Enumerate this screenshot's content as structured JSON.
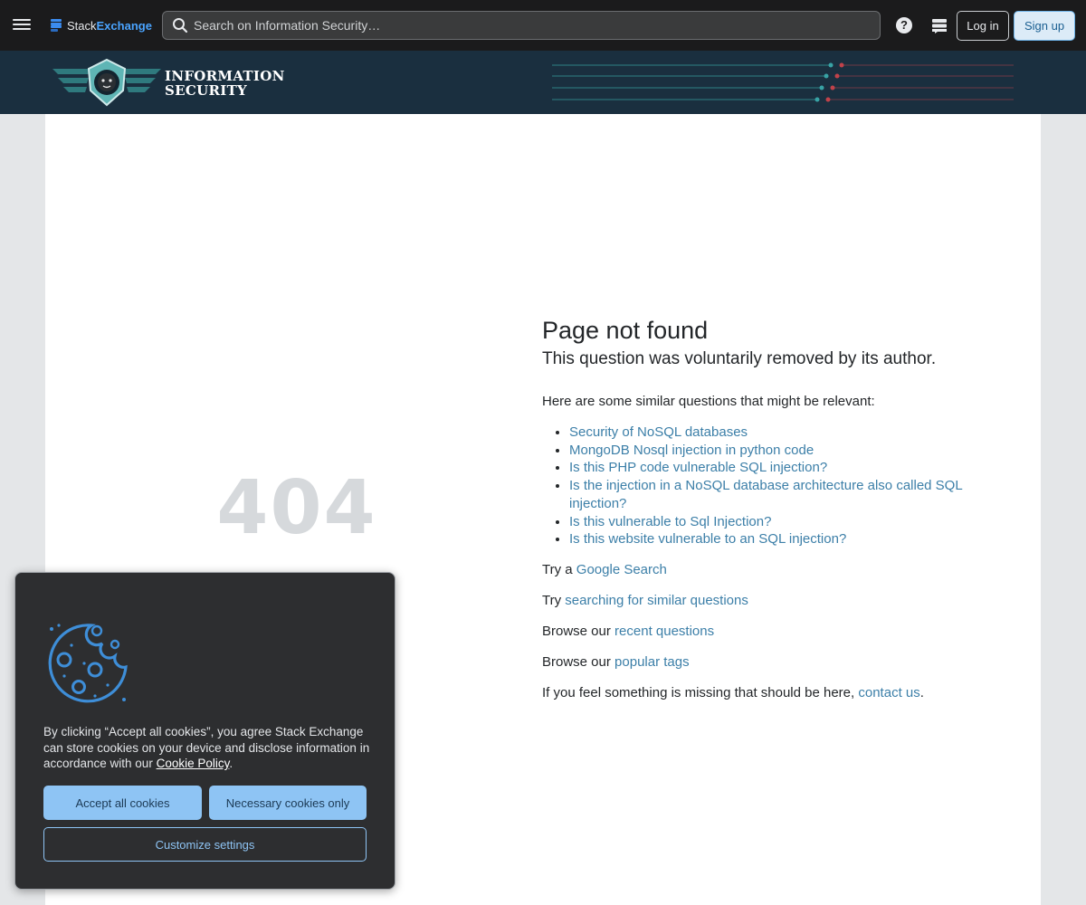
{
  "topbar": {
    "brand_primary": "Stack",
    "brand_secondary": "Exchange",
    "search_placeholder": "Search on Information Security…",
    "login_label": "Log in",
    "signup_label": "Sign up",
    "icons": [
      "hamburger-icon",
      "stack-exchange-logo",
      "search-icon",
      "help-icon",
      "inbox-icon"
    ]
  },
  "banner": {
    "site_name_line1": "INFORMATION",
    "site_name_line2": "SECURITY",
    "emblem": "lion-shield-emblem"
  },
  "error": {
    "code": "404",
    "title": "Page not found",
    "subtitle": "This question was voluntarily removed by its author.",
    "similar_intro": "Here are some similar questions that might be relevant:",
    "similar_questions": [
      "Security of NoSQL databases",
      "MongoDB Nosql injection in python code",
      "Is this PHP code vulnerable SQL injection?",
      "Is the injection in a NoSQL database architecture also called SQL injection?",
      "Is this vulnerable to Sql Injection?",
      "Is this website vulnerable to an SQL injection?"
    ],
    "google_prefix": "Try a",
    "google_link": "Google Search",
    "search_prefix": "Try",
    "search_link": "searching for similar questions",
    "recent_prefix": "Browse our",
    "recent_link": "recent questions",
    "tags_prefix": "Browse our",
    "tags_link": "popular tags",
    "missing_prefix": "If you feel something is missing that should be here,",
    "missing_link": "contact us",
    "missing_suffix": "."
  },
  "cookie": {
    "text_before": "By clicking “Accept all cookies”, you agree Stack Exchange can store cookies on your device and disclose information in accordance with our",
    "policy_link": "Cookie Policy",
    "text_after": ".",
    "accept_label": "Accept all cookies",
    "necessary_label": "Necessary cookies only",
    "customize_label": "Customize settings",
    "icon": "cookie-icon"
  },
  "colors": {
    "topbar_bg": "#1b1b1c",
    "banner_bg": "#1a2f3f",
    "link": "#3c7fa8",
    "cookie_button": "#8ec4f4",
    "teal_accent": "#38a3a5",
    "red_accent": "#c0424a"
  }
}
